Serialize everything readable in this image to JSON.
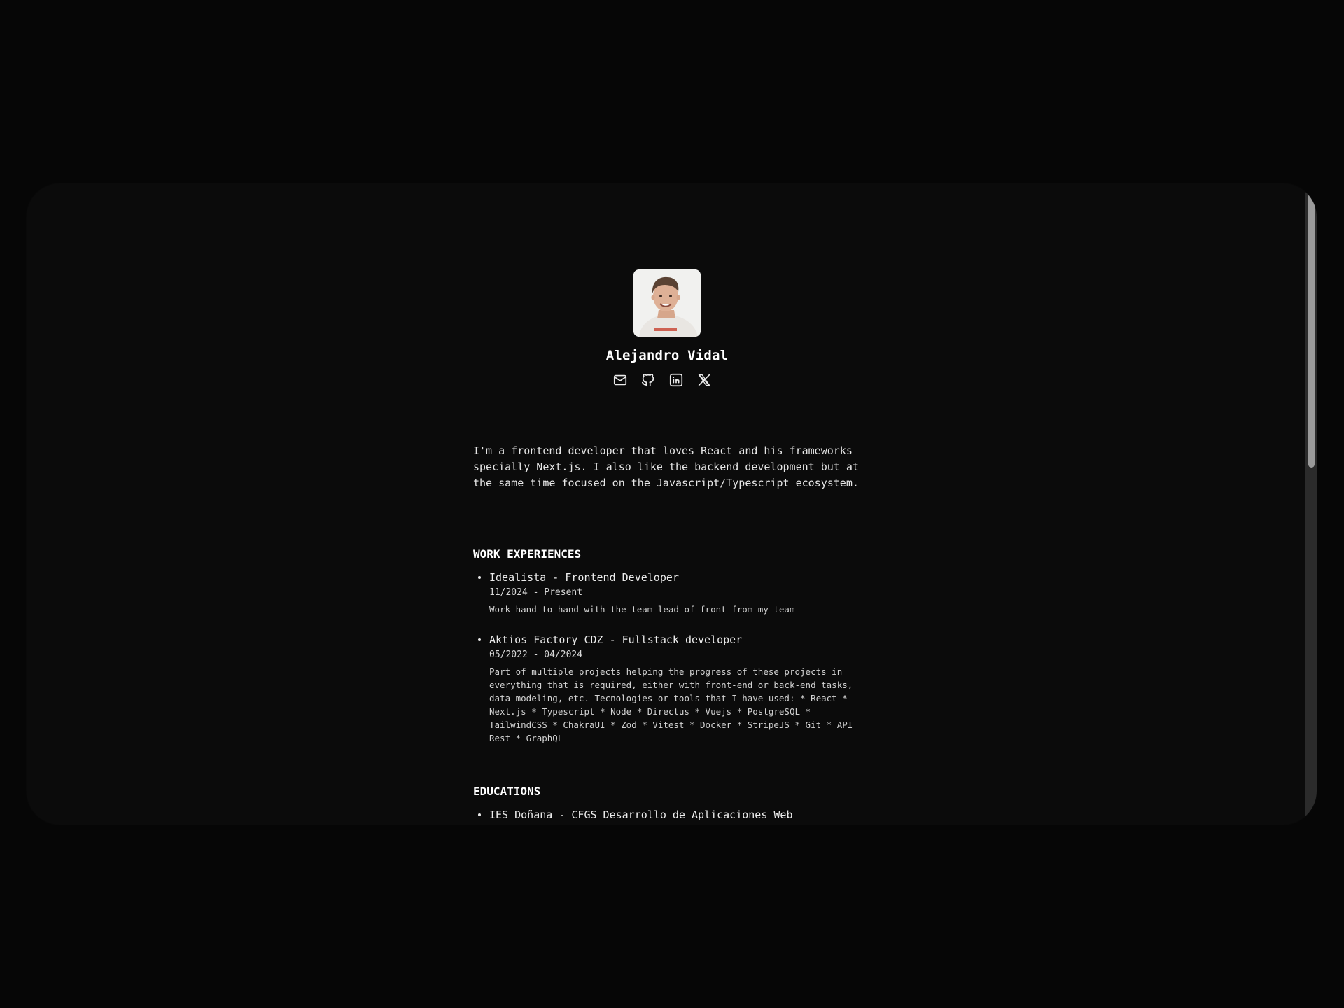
{
  "profile": {
    "name": "Alejandro Vidal",
    "avatar_alt": "Profile photo"
  },
  "socials": [
    {
      "icon": "mail-icon",
      "label": "Email"
    },
    {
      "icon": "github-icon",
      "label": "GitHub"
    },
    {
      "icon": "linkedin-icon",
      "label": "LinkedIn"
    },
    {
      "icon": "x-icon",
      "label": "X"
    }
  ],
  "bio": "I'm a frontend developer that loves React and his frameworks specially Next.js. I also like the backend development but at the same time focused on the Javascript/Typescript ecosystem.",
  "work": {
    "title": "WORK EXPERIENCES",
    "items": [
      {
        "title": "Idealista - Frontend Developer",
        "dates": "11/2024 - Present",
        "description": "Work hand to hand with the team lead of front from my team"
      },
      {
        "title": "Aktios Factory CDZ - Fullstack developer",
        "dates": "05/2022 - 04/2024",
        "description": "Part of multiple projects helping the progress of these projects in everything that is required, either with front-end or back-end tasks, data modeling, etc. Tecnologies or tools that I have used: * React * Next.js * Typescript * Node * Directus * Vuejs * PostgreSQL * TailwindCSS * ChakraUI * Zod * Vitest * Docker * StripeJS * Git * API Rest * GraphQL"
      }
    ]
  },
  "education": {
    "title": "EDUCATIONS",
    "items": [
      {
        "title": "IES Doñana - CFGS Desarrollo de Aplicaciones Web"
      }
    ]
  }
}
